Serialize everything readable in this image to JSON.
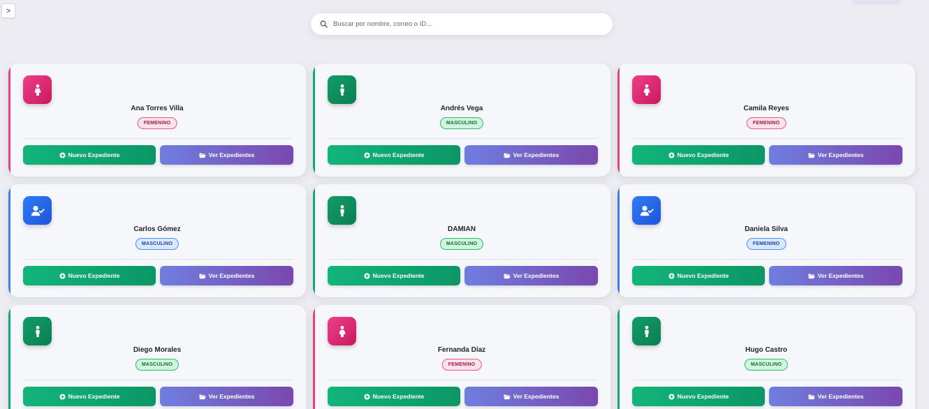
{
  "sidebar_toggle": {
    "label": ">"
  },
  "search": {
    "placeholder": "Buscar por nombre, correo o ID..."
  },
  "colors": {
    "pink": "#e2437e",
    "green": "#13a86e",
    "blue": "#3a7ef0",
    "new_button": "#0fa871",
    "view_button": "#7464c6"
  },
  "buttons": {
    "new_label": "Nuevo Expediente",
    "view_label": "Ver Expedientes"
  },
  "patients": [
    {
      "name": "Ana Torres Villa",
      "gender": "FEMENINO",
      "accent": "pink",
      "avatar": "pink",
      "icon": "female-icon"
    },
    {
      "name": "Andrés Vega",
      "gender": "MASCULINO",
      "accent": "green",
      "avatar": "green",
      "icon": "male-icon"
    },
    {
      "name": "Camila Reyes",
      "gender": "FEMENINO",
      "accent": "pink",
      "avatar": "pink",
      "icon": "female-icon"
    },
    {
      "name": "Carlos Gómez",
      "gender": "MASCULINO",
      "accent": "blue",
      "avatar": "blue",
      "icon": "user-check-icon"
    },
    {
      "name": "DAMIAN",
      "gender": "MASCULINO",
      "accent": "green",
      "avatar": "green",
      "icon": "male-icon"
    },
    {
      "name": "Daniela Silva",
      "gender": "FEMENINO",
      "accent": "blue",
      "avatar": "blue",
      "icon": "user-check-icon"
    },
    {
      "name": "Diego Morales",
      "gender": "MASCULINO",
      "accent": "green",
      "avatar": "green",
      "icon": "male-icon"
    },
    {
      "name": "Fernanda Díaz",
      "gender": "FEMENINO",
      "accent": "pink",
      "avatar": "pink",
      "icon": "female-icon"
    },
    {
      "name": "Hugo Castro",
      "gender": "MASCULINO",
      "accent": "green",
      "avatar": "green",
      "icon": "male-icon"
    }
  ]
}
